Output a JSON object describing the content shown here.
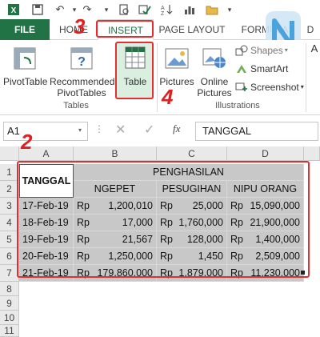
{
  "tabs": {
    "file": "FILE",
    "home": "HOME",
    "insert": "INSERT",
    "page_layout": "PAGE LAYOUT",
    "formulas": "FORMULAS",
    "data": "D"
  },
  "ribbon": {
    "pivottable": "PivotTable",
    "recommended_line1": "Recommended",
    "recommended_line2": "PivotTables",
    "table": "Table",
    "pictures": "Pictures",
    "online_line1": "Online",
    "online_line2": "Pictures",
    "shapes": "Shapes",
    "smartart": "SmartArt",
    "screenshot": "Screenshot",
    "group_tables": "Tables",
    "group_illustrations": "Illustrations",
    "addins_fragment": "A"
  },
  "formula_bar": {
    "name_box": "A1",
    "fx": "fx",
    "content": "TANGGAL"
  },
  "grid": {
    "columns": [
      "A",
      "B",
      "C",
      "D"
    ],
    "rows": [
      "1",
      "2",
      "3",
      "4",
      "5",
      "6",
      "7",
      "8",
      "9",
      "10",
      "11"
    ],
    "header_tanggal": "TANGGAL",
    "header_penghasilan": "PENGHASILAN",
    "sub_headers": [
      "NGEPET",
      "PESUGIHAN",
      "NIPU ORANG"
    ],
    "data": [
      {
        "date": "17-Feb-19",
        "b": "1,200,010",
        "c": "25,000",
        "d": "15,090,000"
      },
      {
        "date": "18-Feb-19",
        "b": "17,000",
        "c": "1,760,000",
        "d": "21,900,000"
      },
      {
        "date": "19-Feb-19",
        "b": "21,567",
        "c": "128,000",
        "d": "1,400,000"
      },
      {
        "date": "20-Feb-19",
        "b": "1,250,000",
        "c": "1,450",
        "d": "2,509,000"
      },
      {
        "date": "21-Feb-19",
        "b": "179,860,000",
        "c": "1,879,000",
        "d": "11,230,000"
      }
    ],
    "currency": "Rp"
  },
  "annotations": {
    "n2": "2",
    "n3": "3",
    "n4": "4"
  },
  "colors": {
    "excel_green": "#217346",
    "annotation_red": "#e03030",
    "selection": "#c8c8c8"
  }
}
